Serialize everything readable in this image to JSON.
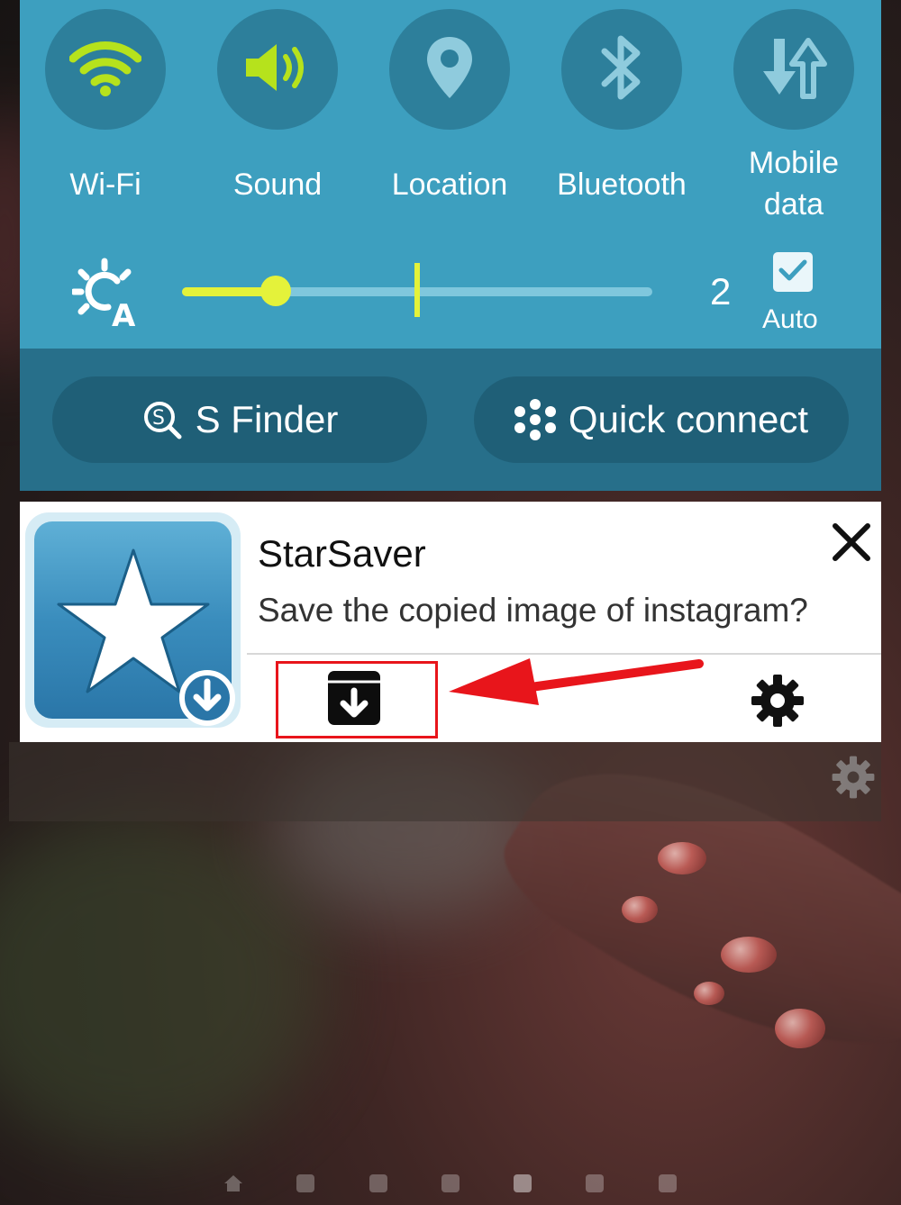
{
  "quick_settings": {
    "toggles": [
      {
        "label": "Wi-Fi",
        "icon": "wifi-icon",
        "state": "on"
      },
      {
        "label": "Sound",
        "icon": "sound-icon",
        "state": "on"
      },
      {
        "label": "Location",
        "icon": "location-icon",
        "state": "off"
      },
      {
        "label": "Bluetooth",
        "icon": "bluetooth-icon",
        "state": "off"
      },
      {
        "label_line1": "Mobile",
        "label_line2": "data",
        "icon": "mobile-data-icon",
        "state": "off"
      }
    ],
    "brightness": {
      "icon": "auto-brightness-icon",
      "level_fraction": 0.2,
      "marker_fraction": 0.5,
      "value": "2",
      "auto_label": "Auto",
      "auto_checked": true
    },
    "buttons": {
      "s_finder": "S Finder",
      "quick_connect": "Quick connect"
    }
  },
  "notification": {
    "app_name": "StarSaver",
    "message": "Save the copied image of instagram?",
    "actions": [
      "save-archive-icon",
      "settings-gear-icon"
    ],
    "dismiss_icon": "close-icon"
  },
  "colors": {
    "panel_blue": "#3d9fbf",
    "toggle_circle": "#2d7f9b",
    "active_green": "#b6e21c",
    "slider_yellow": "#e4f23a",
    "button_bar": "#276f8a",
    "annotation_red": "#e8151b"
  }
}
